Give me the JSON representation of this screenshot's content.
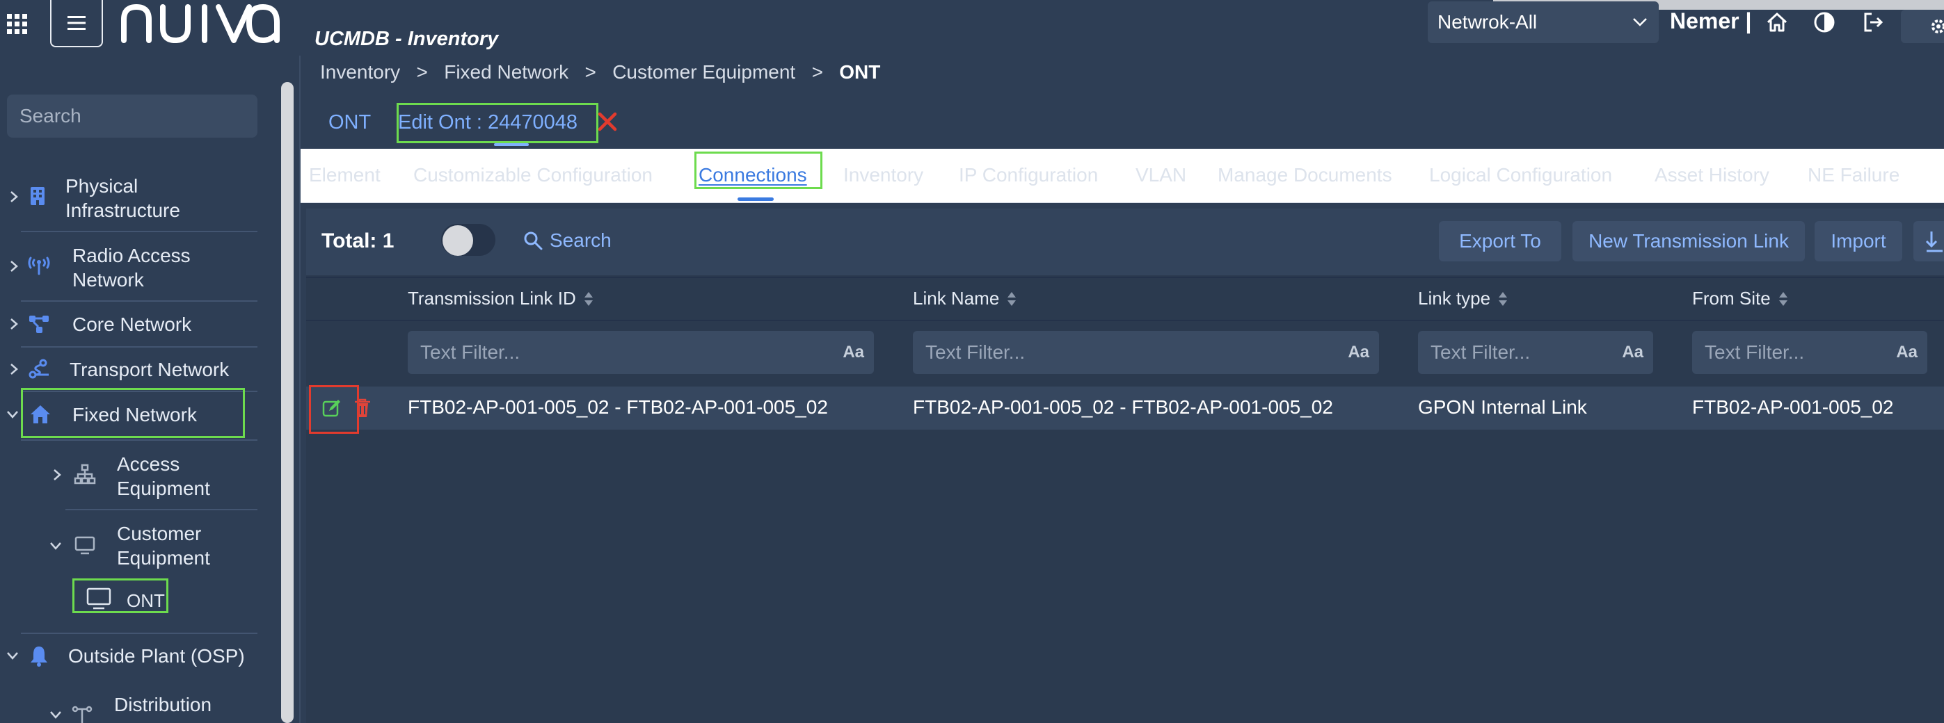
{
  "header": {
    "logo_text": "nuiva",
    "app_title": "UCMDB - Inventory",
    "network_select": {
      "value": "Netwrok-All"
    },
    "user_name": "Nemer |"
  },
  "sidebar": {
    "search_placeholder": "Search",
    "items": [
      {
        "label_line1": "Physical",
        "label_line2": "Infrastructure",
        "icon": "building-icon",
        "state": "collapsed"
      },
      {
        "label_line1": "Radio Access",
        "label_line2": "Network",
        "icon": "antenna-icon",
        "state": "collapsed"
      },
      {
        "label_line1": "Core Network",
        "icon": "network-nodes-icon",
        "state": "collapsed"
      },
      {
        "label_line1": "Transport Network",
        "icon": "transport-icon",
        "state": "collapsed"
      },
      {
        "label_line1": "Fixed Network",
        "icon": "home-icon",
        "state": "expanded"
      },
      {
        "label_line1": "Access",
        "label_line2": "Equipment",
        "icon": "hierarchy-icon",
        "state": "collapsed"
      },
      {
        "label_line1": "Customer",
        "label_line2": "Equipment",
        "icon": "monitor-icon",
        "state": "expanded"
      },
      {
        "label_line1": "ONT",
        "icon": "monitor-icon",
        "state": "selected"
      },
      {
        "label_line1": "Outside Plant (OSP)",
        "icon": "bell-icon",
        "state": "expanded"
      },
      {
        "label_line1": "Distribution",
        "icon": "distribution-icon",
        "state": "expanded"
      }
    ]
  },
  "breadcrumb": {
    "items": [
      "Inventory",
      "Fixed Network",
      "Customer Equipment"
    ],
    "separator": ">",
    "current": "ONT"
  },
  "page_tabs": {
    "ont": "ONT",
    "edit": "Edit Ont : 24470048"
  },
  "subtabs": [
    "Element",
    "Customizable Configuration",
    "Connections",
    "Inventory",
    "IP Configuration",
    "VLAN",
    "Manage Documents",
    "Logical Configuration",
    "Asset History",
    "NE Failure"
  ],
  "active_subtab": "Connections",
  "grid": {
    "total_label": "Total: 1",
    "search_label": "Search",
    "buttons": {
      "export": "Export To",
      "new_link": "New Transmission Link",
      "import": "Import"
    },
    "columns": [
      "Transmission Link ID",
      "Link Name",
      "Link type",
      "From Site"
    ],
    "filter_placeholder": "Text Filter...",
    "filter_case_label": "Aa",
    "rows": [
      [
        "FTB02-AP-001-005_02 - FTB02-AP-001-005_02",
        "FTB02-AP-001-005_02 - FTB02-AP-001-005_02",
        "GPON Internal Link",
        "FTB02-AP-001-005_02"
      ]
    ]
  },
  "colors": {
    "background": "#2e3e55",
    "accent_blue": "#7fb0ff",
    "highlight_green": "#6ddb4e",
    "highlight_red": "#e23b2e",
    "delete_red": "#e0443a"
  }
}
